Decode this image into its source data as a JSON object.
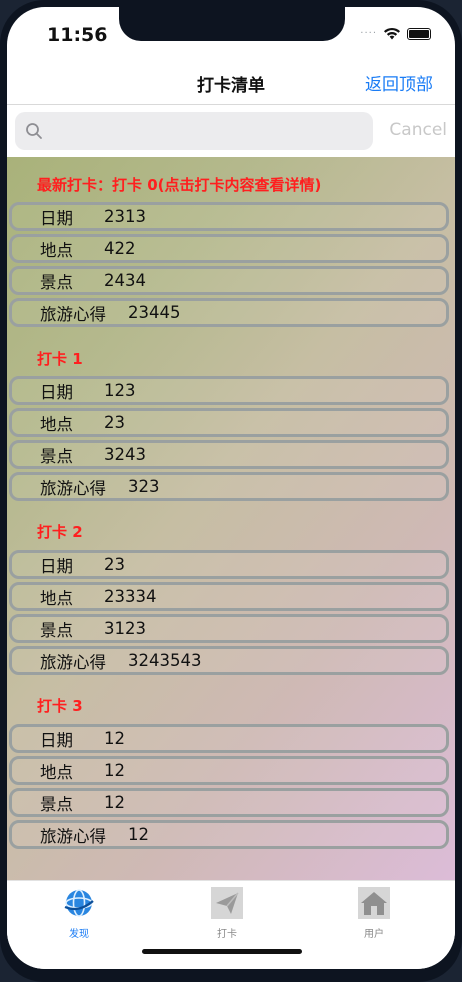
{
  "status": {
    "time": "11:56",
    "signal": "····"
  },
  "navbar": {
    "title": "打卡清单",
    "right_button": "返回顶部"
  },
  "search": {
    "placeholder": "",
    "cancel_label": "Cancel"
  },
  "sections": [
    {
      "title": "最新打卡：打卡 0(点击打卡内容查看详情)",
      "rows": [
        {
          "label": "日期",
          "value": "2313"
        },
        {
          "label": "地点",
          "value": "422"
        },
        {
          "label": "景点",
          "value": "2434"
        },
        {
          "label": "旅游心得",
          "value": "23445"
        }
      ]
    },
    {
      "title": "打卡 1",
      "rows": [
        {
          "label": "日期",
          "value": "123"
        },
        {
          "label": "地点",
          "value": "23"
        },
        {
          "label": "景点",
          "value": "3243"
        },
        {
          "label": "旅游心得",
          "value": "323"
        }
      ]
    },
    {
      "title": "打卡 2",
      "rows": [
        {
          "label": "日期",
          "value": "23"
        },
        {
          "label": "地点",
          "value": "23334"
        },
        {
          "label": "景点",
          "value": "3123"
        },
        {
          "label": "旅游心得",
          "value": "3243543"
        }
      ]
    },
    {
      "title": "打卡 3",
      "rows": [
        {
          "label": "日期",
          "value": "12"
        },
        {
          "label": "地点",
          "value": "12"
        },
        {
          "label": "景点",
          "value": "12"
        },
        {
          "label": "旅游心得",
          "value": "12"
        }
      ]
    }
  ],
  "tabbar": {
    "tabs": [
      {
        "label": "发现",
        "icon": "globe-icon",
        "active": true
      },
      {
        "label": "打卡",
        "icon": "paper-plane-icon",
        "active": false
      },
      {
        "label": "用户",
        "icon": "house-icon",
        "active": false
      }
    ]
  },
  "colors": {
    "accent": "#1a7cf5",
    "section_title": "#ff1f1f"
  }
}
